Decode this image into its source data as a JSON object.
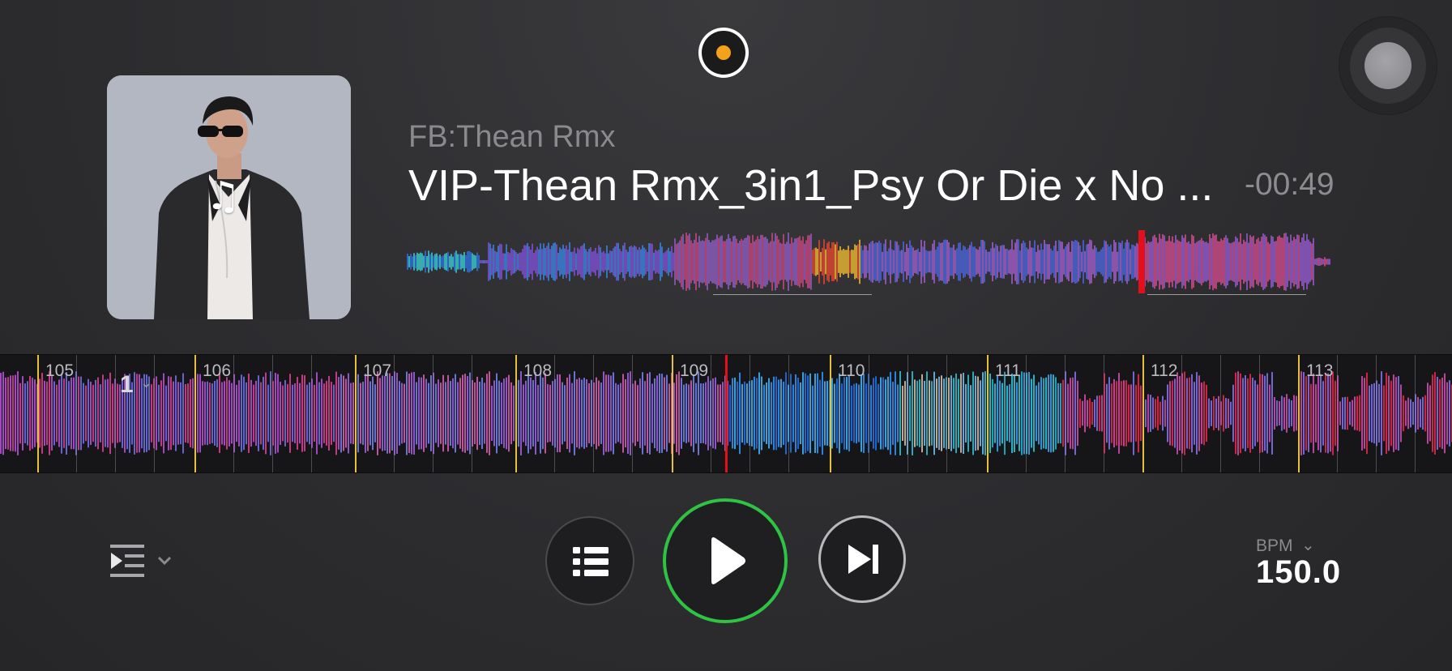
{
  "track": {
    "artist": "FB:Thean Rmx",
    "title": "VIP-Thean Rmx_3in1_Psy Or Die x No ...",
    "time_remaining": "-00:49"
  },
  "waveform": {
    "beat_markers": [
      "105",
      "106",
      "107",
      "108",
      "109",
      "110",
      "111",
      "112",
      "113"
    ],
    "cue_label": "1"
  },
  "controls": {
    "list_icon": "list-icon",
    "play_icon": "play-icon",
    "next_icon": "skip-next-icon",
    "queue_mode_icon": "queue-play-icon"
  },
  "bpm": {
    "label": "BPM",
    "value": "150.0"
  },
  "colors": {
    "play_ring": "#2ec343",
    "record_dot": "#f2a21b",
    "playhead": "#e3101c",
    "beat_line": "#e5c23a"
  },
  "icons": {
    "record": "record-indicator-icon",
    "jog": "jog-knob-icon",
    "music_note": "music-note-icon"
  }
}
